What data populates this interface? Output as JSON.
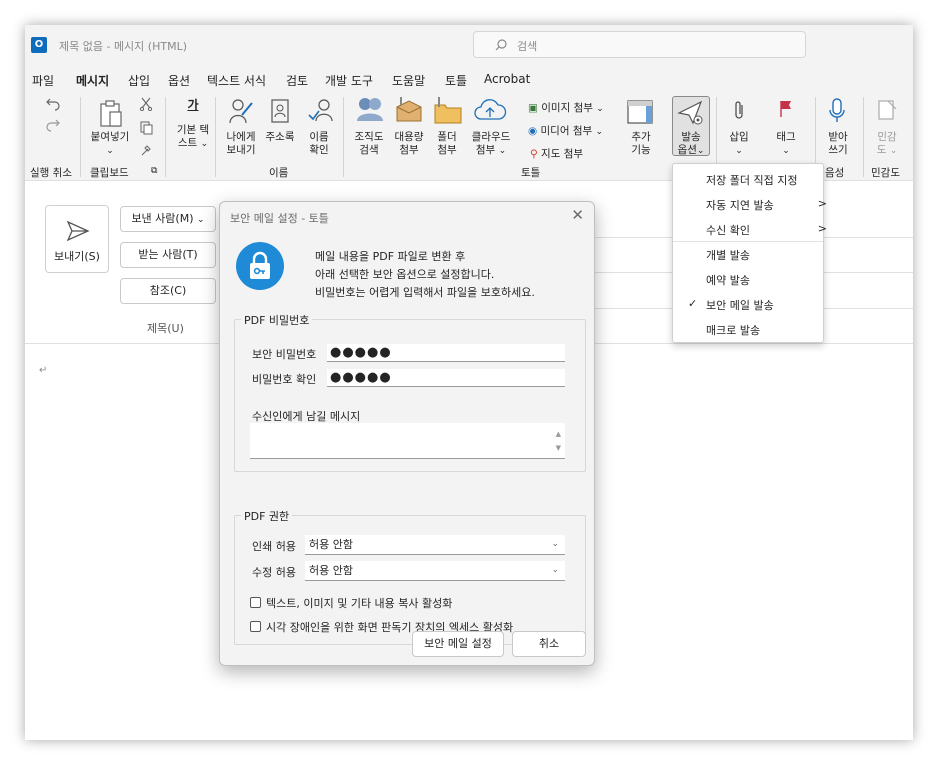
{
  "title_bar": {
    "app_title": "제목 없음 - 메시지 (HTML)",
    "search_placeholder": "검색"
  },
  "menu": {
    "tabs": [
      "파일",
      "메시지",
      "삽입",
      "옵션",
      "텍스트 서식",
      "검토",
      "개발 도구",
      "도움말",
      "토틀",
      "Acrobat"
    ],
    "active": "메시지"
  },
  "ribbon": {
    "undo_group": "실행 취소",
    "clipboard": {
      "paste": "붙여넣기",
      "group": "클립보드"
    },
    "basic_text": {
      "line1": "기본 텍",
      "line2": "스트",
      "icon_char": "가"
    },
    "names": {
      "address_self_line1": "나에게",
      "address_self_line2": "보내기",
      "address_book": "주소록",
      "check_names_line1": "이름",
      "check_names_line2": "확인",
      "group": "이름"
    },
    "totl": {
      "org_search": [
        "조직도",
        "검색"
      ],
      "large_attach": [
        "대용량",
        "첨부"
      ],
      "folder_attach": [
        "폴더",
        "첨부"
      ],
      "cloud_attach": [
        "클라우드",
        "첨부"
      ],
      "image_attach": "이미지 첨부",
      "media_attach": "미디어 첨부",
      "map_attach": "지도 첨부",
      "add_features": [
        "추가",
        "기능"
      ],
      "send_options": [
        "발송",
        "옵션"
      ],
      "group": "토틀"
    },
    "insert": "삽입",
    "tags": "태그",
    "dictate": [
      "받아",
      "쓰기"
    ],
    "voice_group": "음성",
    "sensitivity": [
      "민감",
      "도"
    ],
    "sensitivity_group": "민감도"
  },
  "dropdown": {
    "items": [
      {
        "label": "저장 폴더 직접 지정",
        "submenu": false,
        "checked": false
      },
      {
        "label": "자동 지연 발송",
        "submenu": true,
        "checked": false
      },
      {
        "label": "수신 확인",
        "submenu": true,
        "checked": false
      },
      {
        "label": "개별 발송",
        "submenu": false,
        "checked": false
      },
      {
        "label": "예약 발송",
        "submenu": false,
        "checked": false
      },
      {
        "label": "보안 메일 발송",
        "submenu": false,
        "checked": true
      },
      {
        "label": "매크로 발송",
        "submenu": false,
        "checked": false
      }
    ],
    "arrow": ">",
    "check": "✓"
  },
  "compose": {
    "send": "보내기(S)",
    "from": "보낸 사람(M)",
    "to": "받는 사람(T)",
    "cc": "참조(C)",
    "subject": "제목(U)",
    "caret": "↵"
  },
  "dialog": {
    "title": "보안 메일 설정 - 토틀",
    "message_lines": [
      "메일 내용을 PDF 파일로 변환 후",
      "아래 선택한 보안 옵션으로 설정합니다.",
      "비밀번호는 어렵게 입력해서 파일을 보호하세요."
    ],
    "pdf_password_legend": "PDF 비밀번호",
    "password_label": "보안 비밀번호",
    "password_value": "●●●●●",
    "confirm_label": "비밀번호 확인",
    "confirm_value": "●●●●●",
    "message_label": "수신인에게 남길 메시지",
    "message_value": "",
    "pdf_permission_legend": "PDF 권한",
    "print_label": "인쇄 허용",
    "print_value": "허용 안함",
    "edit_label": "수정 허용",
    "edit_value": "허용 안함",
    "copy_checkbox": "텍스트, 이미지 및 기타 내용 복사 활성화",
    "accessibility_checkbox": "시각 장애인을 위한 화면 판독기 장치의 엑세스 활성화",
    "ok_button": "보안 메일 설정",
    "cancel_button": "취소"
  }
}
